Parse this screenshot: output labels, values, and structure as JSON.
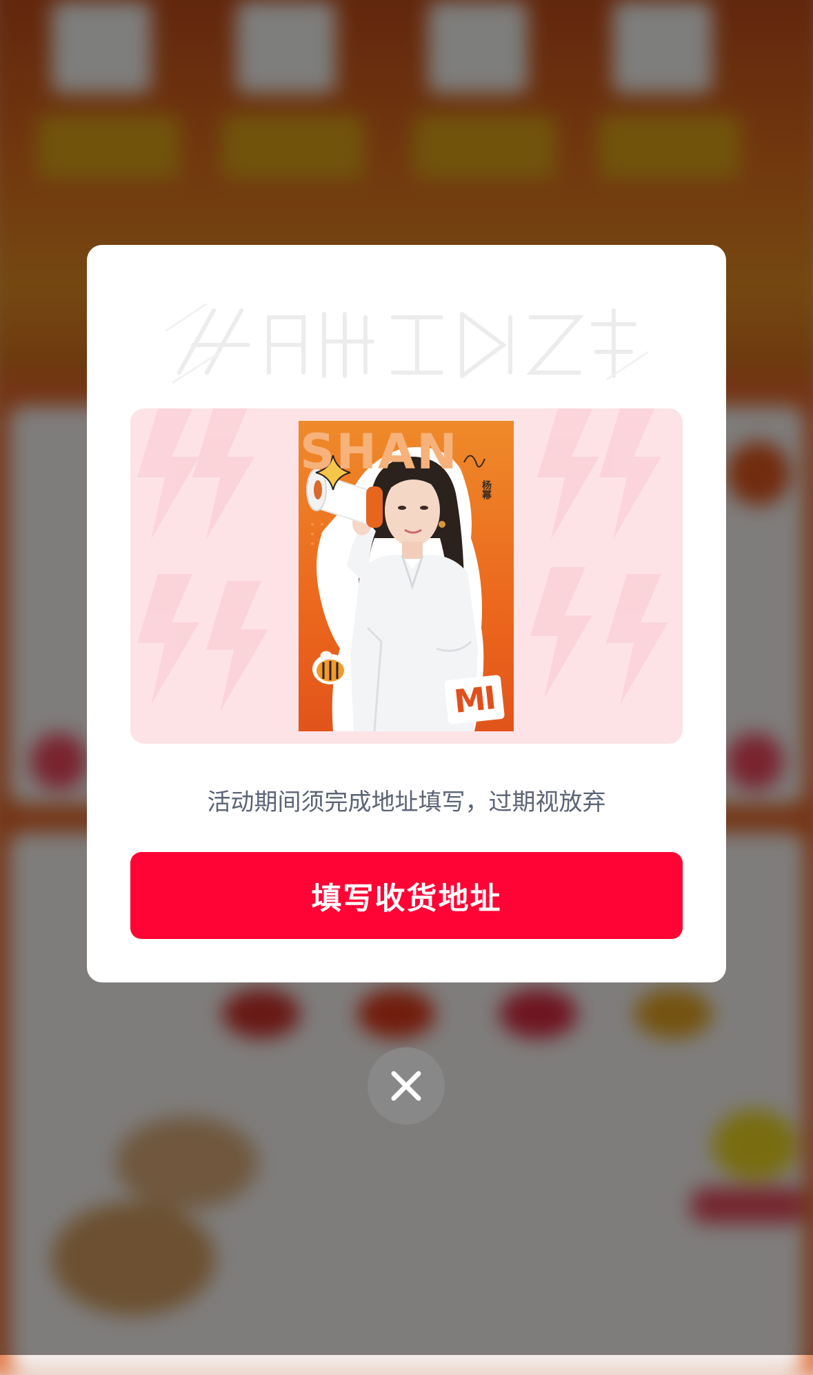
{
  "modal": {
    "title_ghost_icon": "faded-title-artwork",
    "banner": {
      "poster_icon": "spokesperson-poster",
      "brand_text": "SHAN",
      "endorser_name": "杨幂",
      "badge_text": "MI",
      "megaphone_icon": "megaphone-icon",
      "bee_icon": "bee-mascot-icon"
    },
    "notice": "活动期间须完成地址填写，过期视放弃",
    "cta_label": "填写收货地址"
  },
  "close_icon": "close-icon",
  "colors": {
    "cta": "#ff0434",
    "notice_text": "#5b6475",
    "banner_bg": "#fde3e6",
    "poster_orange": "#ec6a1e"
  }
}
